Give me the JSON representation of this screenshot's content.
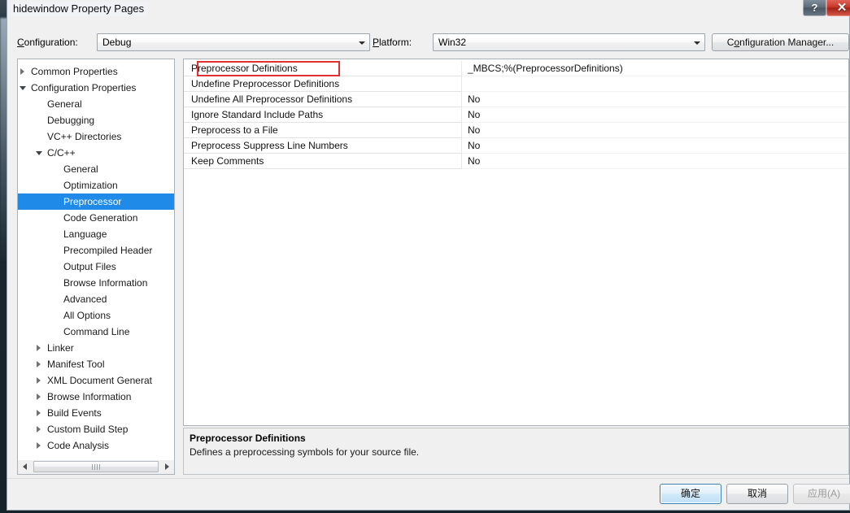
{
  "window": {
    "title": "hidewindow Property Pages",
    "help_button": "?",
    "close_button": "✕"
  },
  "toolbar": {
    "configuration_label": "Configuration:",
    "configuration_label_accel": "C",
    "configuration_value": "Debug",
    "platform_label": "Platform:",
    "platform_label_accel": "P",
    "platform_value": "Win32",
    "configuration_manager_label": "Configuration Manager...",
    "configuration_manager_accel": "o"
  },
  "tree": {
    "items": [
      {
        "label": "Common Properties",
        "indent": 0,
        "twisty": "collapsed",
        "selected": false
      },
      {
        "label": "Configuration Properties",
        "indent": 0,
        "twisty": "expanded",
        "selected": false
      },
      {
        "label": "General",
        "indent": 1,
        "twisty": "none",
        "selected": false
      },
      {
        "label": "Debugging",
        "indent": 1,
        "twisty": "none",
        "selected": false
      },
      {
        "label": "VC++ Directories",
        "indent": 1,
        "twisty": "none",
        "selected": false
      },
      {
        "label": "C/C++",
        "indent": 1,
        "twisty": "expanded",
        "selected": false
      },
      {
        "label": "General",
        "indent": 2,
        "twisty": "none",
        "selected": false
      },
      {
        "label": "Optimization",
        "indent": 2,
        "twisty": "none",
        "selected": false
      },
      {
        "label": "Preprocessor",
        "indent": 2,
        "twisty": "none",
        "selected": true
      },
      {
        "label": "Code Generation",
        "indent": 2,
        "twisty": "none",
        "selected": false
      },
      {
        "label": "Language",
        "indent": 2,
        "twisty": "none",
        "selected": false
      },
      {
        "label": "Precompiled Header",
        "indent": 2,
        "twisty": "none",
        "selected": false
      },
      {
        "label": "Output Files",
        "indent": 2,
        "twisty": "none",
        "selected": false
      },
      {
        "label": "Browse Information",
        "indent": 2,
        "twisty": "none",
        "selected": false
      },
      {
        "label": "Advanced",
        "indent": 2,
        "twisty": "none",
        "selected": false
      },
      {
        "label": "All Options",
        "indent": 2,
        "twisty": "none",
        "selected": false
      },
      {
        "label": "Command Line",
        "indent": 2,
        "twisty": "none",
        "selected": false
      },
      {
        "label": "Linker",
        "indent": 1,
        "twisty": "collapsed",
        "selected": false
      },
      {
        "label": "Manifest Tool",
        "indent": 1,
        "twisty": "collapsed",
        "selected": false
      },
      {
        "label": "XML Document Generat",
        "indent": 1,
        "twisty": "collapsed",
        "selected": false
      },
      {
        "label": "Browse Information",
        "indent": 1,
        "twisty": "collapsed",
        "selected": false
      },
      {
        "label": "Build Events",
        "indent": 1,
        "twisty": "collapsed",
        "selected": false
      },
      {
        "label": "Custom Build Step",
        "indent": 1,
        "twisty": "collapsed",
        "selected": false
      },
      {
        "label": "Code Analysis",
        "indent": 1,
        "twisty": "collapsed",
        "selected": false
      }
    ]
  },
  "grid": {
    "rows": [
      {
        "name": "Preprocessor Definitions",
        "value": "_MBCS;%(PreprocessorDefinitions)",
        "highlighted": true
      },
      {
        "name": "Undefine Preprocessor Definitions",
        "value": "",
        "highlighted": false
      },
      {
        "name": "Undefine All Preprocessor Definitions",
        "value": "No",
        "highlighted": false
      },
      {
        "name": "Ignore Standard Include Paths",
        "value": "No",
        "highlighted": false
      },
      {
        "name": "Preprocess to a File",
        "value": "No",
        "highlighted": false
      },
      {
        "name": "Preprocess Suppress Line Numbers",
        "value": "No",
        "highlighted": false
      },
      {
        "name": "Keep Comments",
        "value": "No",
        "highlighted": false
      }
    ],
    "highlight_color": "#e03030"
  },
  "description": {
    "title": "Preprocessor Definitions",
    "body": "Defines a preprocessing symbols for your source file."
  },
  "footer": {
    "ok_label": "确定",
    "cancel_label": "取消",
    "apply_label": "应用(A)",
    "apply_enabled": false
  },
  "colors": {
    "selection_blue": "#1f8ae8",
    "dialog_bg": "#f0f0f0",
    "close_red": "#c63527"
  }
}
